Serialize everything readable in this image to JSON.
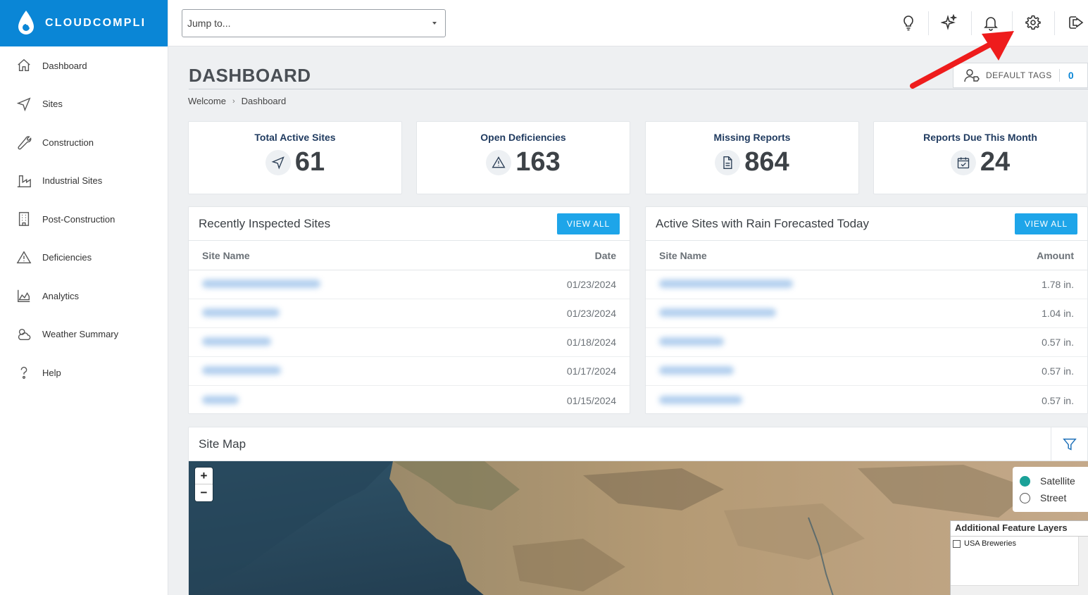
{
  "app": {
    "brand": "CLOUDCOMPLI",
    "brand_color": "#0a86d6"
  },
  "sidebar": {
    "items": [
      {
        "label": "Dashboard",
        "icon": "home-icon"
      },
      {
        "label": "Sites",
        "icon": "navigation-arrow-icon"
      },
      {
        "label": "Construction",
        "icon": "wrench-icon"
      },
      {
        "label": "Industrial Sites",
        "icon": "factory-icon"
      },
      {
        "label": "Post-Construction",
        "icon": "building-icon"
      },
      {
        "label": "Deficiencies",
        "icon": "warning-triangle-icon"
      },
      {
        "label": "Analytics",
        "icon": "area-chart-icon"
      },
      {
        "label": "Weather Summary",
        "icon": "cloud-sun-icon"
      },
      {
        "label": "Help",
        "icon": "question-icon"
      }
    ]
  },
  "topbar": {
    "jump_placeholder": "Jump to...",
    "icons": [
      "lightbulb-icon",
      "sparkles-icon",
      "bell-icon",
      "gear-icon",
      "logout-icon"
    ]
  },
  "page": {
    "title": "DASHBOARD",
    "breadcrumb": [
      "Welcome",
      "Dashboard"
    ],
    "default_tags_label": "DEFAULT TAGS",
    "default_tags_count": "0"
  },
  "stats": [
    {
      "title": "Total Active Sites",
      "value": "61",
      "icon": "navigation-arrow-icon"
    },
    {
      "title": "Open Deficiencies",
      "value": "163",
      "icon": "warning-triangle-icon"
    },
    {
      "title": "Missing Reports",
      "value": "864",
      "icon": "document-icon"
    },
    {
      "title": "Reports Due This Month",
      "value": "24",
      "icon": "calendar-check-icon"
    }
  ],
  "recent": {
    "title": "Recently Inspected Sites",
    "button": "VIEW ALL",
    "col1": "Site Name",
    "col2": "Date",
    "rows": [
      {
        "date": "01/23/2024"
      },
      {
        "date": "01/23/2024"
      },
      {
        "date": "01/18/2024"
      },
      {
        "date": "01/17/2024"
      },
      {
        "date": "01/15/2024"
      }
    ]
  },
  "rain": {
    "title": "Active Sites with Rain Forecasted Today",
    "button": "VIEW ALL",
    "col1": "Site Name",
    "col2": "Amount",
    "rows": [
      {
        "amount": "1.78 in."
      },
      {
        "amount": "1.04 in."
      },
      {
        "amount": "0.57 in."
      },
      {
        "amount": "0.57 in."
      },
      {
        "amount": "0.57 in."
      }
    ]
  },
  "map": {
    "title": "Site Map",
    "zoom_in": "+",
    "zoom_out": "−",
    "basemaps": [
      "Satellite",
      "Street"
    ],
    "selected_basemap": "Satellite",
    "layers_title": "Additional Feature Layers",
    "layers": [
      "USA Breweries"
    ]
  }
}
